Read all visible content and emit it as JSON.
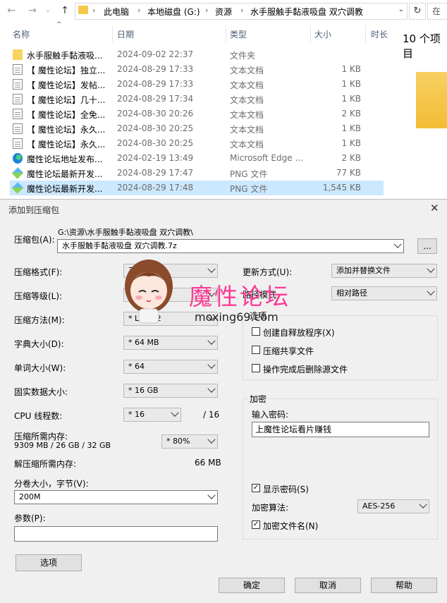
{
  "explorer": {
    "breadcrumb": [
      "此电脑",
      "本地磁盘 (G:)",
      "资源",
      "水手服触手黏液吸盘 双穴调教"
    ],
    "search_placeholder": "在",
    "columns": {
      "name": "名称",
      "date": "日期",
      "type": "类型",
      "size": "大小",
      "extra": "时长"
    },
    "files": [
      {
        "name": "水手服触手黏液吸...",
        "date": "2024-09-02 22:37",
        "type": "文件夹",
        "size": "",
        "icon": "folder-icon"
      },
      {
        "name": "【 魔性论坛】独立...",
        "date": "2024-08-29 17:33",
        "type": "文本文档",
        "size": "1 KB",
        "icon": "text-file-icon"
      },
      {
        "name": "【 魔性论坛】发帖...",
        "date": "2024-08-29 17:33",
        "type": "文本文档",
        "size": "1 KB",
        "icon": "text-file-icon"
      },
      {
        "name": "【 魔性论坛】几十...",
        "date": "2024-08-29 17:34",
        "type": "文本文档",
        "size": "1 KB",
        "icon": "text-file-icon"
      },
      {
        "name": "【 魔性论坛】全免...",
        "date": "2024-08-30 20:26",
        "type": "文本文档",
        "size": "2 KB",
        "icon": "text-file-icon"
      },
      {
        "name": "【 魔性论坛】永久...",
        "date": "2024-08-30 20:25",
        "type": "文本文档",
        "size": "1 KB",
        "icon": "text-file-icon"
      },
      {
        "name": "【 魔性论坛】永久...",
        "date": "2024-08-30 20:25",
        "type": "文本文档",
        "size": "1 KB",
        "icon": "text-file-icon"
      },
      {
        "name": "魔性论坛地址发布...",
        "date": "2024-02-19 13:49",
        "type": "Microsoft Edge ...",
        "size": "2 KB",
        "icon": "edge-icon"
      },
      {
        "name": "魔性论坛最新开发...",
        "date": "2024-08-29 17:47",
        "type": "PNG 文件",
        "size": "77 KB",
        "icon": "png-icon"
      },
      {
        "name": "魔性论坛最新开发...",
        "date": "2024-08-29 17:48",
        "type": "PNG 文件",
        "size": "1,545 KB",
        "icon": "png-icon"
      }
    ],
    "item_count": "10 个项目"
  },
  "dialog": {
    "title": "添加到压缩包",
    "archive_label": "压缩包(A):",
    "archive_path": "G:\\资源\\水手服触手黏液吸盘 双穴调教\\",
    "archive_name": "水手服触手黏液吸盘 双穴调教.7z",
    "browse_label": "...",
    "format_label": "压缩格式(F):",
    "format_value": "7z",
    "level_label": "压缩等级(L):",
    "level_value": "",
    "method_label": "压缩方法(M):",
    "method_value": "* LZMA2",
    "dict_label": "字典大小(D):",
    "dict_value": "* 64 MB",
    "word_label": "单词大小(W):",
    "word_value": "* 64",
    "solid_label": "固实数据大小:",
    "solid_value": "* 16 GB",
    "cpu_label": "CPU 线程数:",
    "cpu_value": "* 16",
    "cpu_total": "/ 16",
    "mem_label": "压缩所需内存:",
    "mem_detail": "9309 MB / 26 GB / 32 GB",
    "mem_percent": "* 80%",
    "decomp_label": "解压缩所需内存:",
    "decomp_value": "66 MB",
    "split_label": "分卷大小，字节(V):",
    "split_value": "200M",
    "params_label": "参数(P):",
    "params_value": "",
    "options_button": "选项",
    "update_label": "更新方式(U):",
    "update_value": "添加并替换文件",
    "path_label": "路径模式",
    "path_value": "相对路径",
    "options_group": "选项",
    "opt_sfx": "创建自释放程序(X)",
    "opt_shared": "压缩共享文件",
    "opt_delete": "操作完成后删除源文件",
    "encrypt_group": "加密",
    "password_label": "输入密码:",
    "password_value": "上魔性论坛看片赚钱",
    "show_password": "显示密码(S)",
    "enc_method_label": "加密算法:",
    "enc_method_value": "AES-256",
    "encrypt_names": "加密文件名(N)",
    "ok": "确定",
    "cancel": "取消",
    "help": "帮助"
  },
  "watermark": {
    "text": "魔性论坛",
    "url": "moxing69.com"
  }
}
